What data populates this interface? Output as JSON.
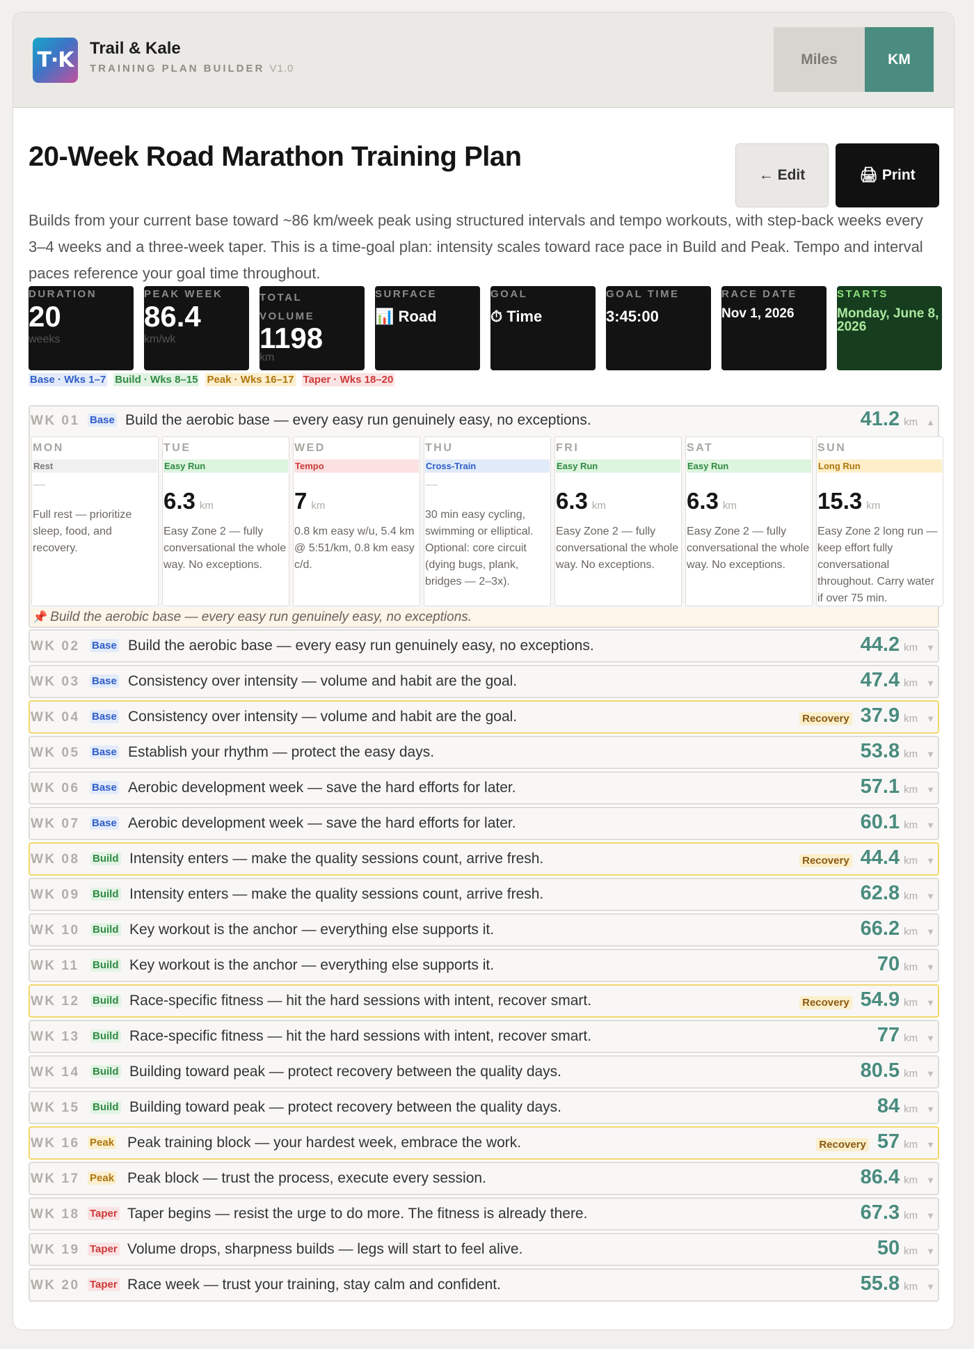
{
  "brand": {
    "logo_text": "T·K",
    "name": "Trail & Kale",
    "subtitle": "TRAINING PLAN BUILDER",
    "version": "V1.0"
  },
  "units": {
    "miles": "Miles",
    "km": "KM",
    "selected": "KM"
  },
  "plan": {
    "title": "20-Week Road Marathon Training Plan",
    "edit_label": "← Edit",
    "print_label": "🖨 Print",
    "description": "Builds from your current base toward ~86 km/week peak using structured intervals and tempo workouts, with step-back weeks every 3–4 weeks and a three-week taper. This is a time-goal plan: intensity scales toward race pace in Build and Peak. Tempo and interval paces reference your goal time throughout."
  },
  "stats": {
    "duration": {
      "label": "DURATION",
      "value": "20",
      "unit": "weeks"
    },
    "peak_week": {
      "label": "PEAK WEEK",
      "value": "86.4",
      "unit": "km/wk"
    },
    "total_volume": {
      "label": "TOTAL VOLUME",
      "value": "1198",
      "unit": "km"
    },
    "surface": {
      "label": "SURFACE",
      "value": "📊 Road"
    },
    "goal": {
      "label": "GOAL",
      "value": "⏱ Time"
    },
    "goal_time": {
      "label": "GOAL TIME",
      "value": "3:45:00"
    },
    "race_date": {
      "label": "RACE DATE",
      "value": "Nov 1, 2026"
    },
    "starts": {
      "label": "STARTS",
      "value": "Monday, June 8, 2026"
    }
  },
  "legend": {
    "base": "Base · Wks 1–7",
    "build": "Build · Wks 8–15",
    "peak": "Peak · Wks 16–17",
    "taper": "Taper · Wks 18–20"
  },
  "km_unit": "km",
  "recovery_label": "Recovery",
  "week1": {
    "num": "WK 01",
    "phase": "Base",
    "focus": "Build the aerobic base — every easy run genuinely easy, no exceptions.",
    "km": "41.2",
    "footer": "Build the aerobic base — every easy run genuinely easy, no exceptions.",
    "days": [
      {
        "name": "MON",
        "type": "Rest",
        "km": "",
        "dash": "—",
        "note": "Full rest — prioritize sleep, food, and recovery."
      },
      {
        "name": "TUE",
        "type": "Easy Run",
        "km": "6.3",
        "dash": "",
        "note": "Easy Zone 2 — fully conversational the whole way. No exceptions."
      },
      {
        "name": "WED",
        "type": "Tempo",
        "km": "7",
        "dash": "",
        "note": "0.8 km easy w/u, 5.4 km @ 5:51/km, 0.8 km easy c/d."
      },
      {
        "name": "THU",
        "type": "Cross-Train",
        "km": "",
        "dash": "—",
        "note": "30 min easy cycling, swimming or elliptical. Optional: core circuit (dying bugs, plank, bridges — 2–3x)."
      },
      {
        "name": "FRI",
        "type": "Easy Run",
        "km": "6.3",
        "dash": "",
        "note": "Easy Zone 2 — fully conversational the whole way. No exceptions."
      },
      {
        "name": "SAT",
        "type": "Easy Run",
        "km": "6.3",
        "dash": "",
        "note": "Easy Zone 2 — fully conversational the whole way. No exceptions."
      },
      {
        "name": "SUN",
        "type": "Long Run",
        "km": "15.3",
        "dash": "",
        "note": "Easy Zone 2 long run — keep effort fully conversational throughout. Carry water if over 75 min."
      }
    ]
  },
  "weeks": [
    {
      "num": "WK 02",
      "phase": "Base",
      "focus": "Build the aerobic base — every easy run genuinely easy, no exceptions.",
      "km": "44.2",
      "recovery": false
    },
    {
      "num": "WK 03",
      "phase": "Base",
      "focus": "Consistency over intensity — volume and habit are the goal.",
      "km": "47.4",
      "recovery": false
    },
    {
      "num": "WK 04",
      "phase": "Base",
      "focus": "Consistency over intensity — volume and habit are the goal.",
      "km": "37.9",
      "recovery": true
    },
    {
      "num": "WK 05",
      "phase": "Base",
      "focus": "Establish your rhythm — protect the easy days.",
      "km": "53.8",
      "recovery": false
    },
    {
      "num": "WK 06",
      "phase": "Base",
      "focus": "Aerobic development week — save the hard efforts for later.",
      "km": "57.1",
      "recovery": false
    },
    {
      "num": "WK 07",
      "phase": "Base",
      "focus": "Aerobic development week — save the hard efforts for later.",
      "km": "60.1",
      "recovery": false
    },
    {
      "num": "WK 08",
      "phase": "Build",
      "focus": "Intensity enters — make the quality sessions count, arrive fresh.",
      "km": "44.4",
      "recovery": true
    },
    {
      "num": "WK 09",
      "phase": "Build",
      "focus": "Intensity enters — make the quality sessions count, arrive fresh.",
      "km": "62.8",
      "recovery": false
    },
    {
      "num": "WK 10",
      "phase": "Build",
      "focus": "Key workout is the anchor — everything else supports it.",
      "km": "66.2",
      "recovery": false
    },
    {
      "num": "WK 11",
      "phase": "Build",
      "focus": "Key workout is the anchor — everything else supports it.",
      "km": "70",
      "recovery": false
    },
    {
      "num": "WK 12",
      "phase": "Build",
      "focus": "Race-specific fitness — hit the hard sessions with intent, recover smart.",
      "km": "54.9",
      "recovery": true
    },
    {
      "num": "WK 13",
      "phase": "Build",
      "focus": "Race-specific fitness — hit the hard sessions with intent, recover smart.",
      "km": "77",
      "recovery": false
    },
    {
      "num": "WK 14",
      "phase": "Build",
      "focus": "Building toward peak — protect recovery between the quality days.",
      "km": "80.5",
      "recovery": false
    },
    {
      "num": "WK 15",
      "phase": "Build",
      "focus": "Building toward peak — protect recovery between the quality days.",
      "km": "84",
      "recovery": false
    },
    {
      "num": "WK 16",
      "phase": "Peak",
      "focus": "Peak training block — your hardest week, embrace the work.",
      "km": "57",
      "recovery": true
    },
    {
      "num": "WK 17",
      "phase": "Peak",
      "focus": "Peak block — trust the process, execute every session.",
      "km": "86.4",
      "recovery": false
    },
    {
      "num": "WK 18",
      "phase": "Taper",
      "focus": "Taper begins — resist the urge to do more. The fitness is already there.",
      "km": "67.3",
      "recovery": false
    },
    {
      "num": "WK 19",
      "phase": "Taper",
      "focus": "Volume drops, sharpness builds — legs will start to feel alive.",
      "km": "50",
      "recovery": false
    },
    {
      "num": "WK 20",
      "phase": "Taper",
      "focus": "Race week — trust your training, stay calm and confident.",
      "km": "55.8",
      "recovery": false
    }
  ],
  "colors": {
    "accent": "#4a8c7f",
    "base": "#2f5ec8",
    "build": "#2f8a43",
    "peak": "#b0760d",
    "taper": "#cc3a3a",
    "recovery_border": "#f1d86c"
  }
}
